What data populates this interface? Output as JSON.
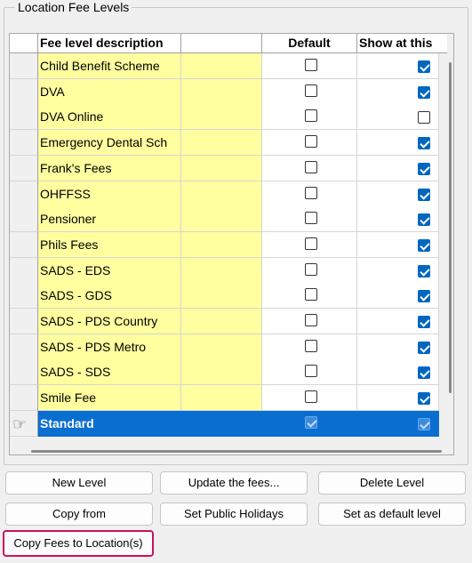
{
  "group": {
    "title": "Location Fee Levels"
  },
  "grid": {
    "columns": [
      "Fee level description",
      "Default",
      "Show at this"
    ],
    "rows": [
      {
        "name": "Child Benefit Scheme",
        "default": false,
        "show": true
      },
      {
        "name": "DVA",
        "default": false,
        "show": true
      },
      {
        "name": "DVA Online",
        "default": false,
        "show": false
      },
      {
        "name": "Emergency Dental Sch",
        "default": false,
        "show": true
      },
      {
        "name": "Frank's Fees",
        "default": false,
        "show": true
      },
      {
        "name": "OHFFSS",
        "default": false,
        "show": true
      },
      {
        "name": "Pensioner",
        "default": false,
        "show": true
      },
      {
        "name": "Phils Fees",
        "default": false,
        "show": true
      },
      {
        "name": "SADS - EDS",
        "default": false,
        "show": true
      },
      {
        "name": "SADS - GDS",
        "default": false,
        "show": true
      },
      {
        "name": "SADS - PDS Country",
        "default": false,
        "show": true
      },
      {
        "name": "SADS - PDS Metro",
        "default": false,
        "show": true
      },
      {
        "name": "SADS - SDS",
        "default": false,
        "show": true
      },
      {
        "name": "Smile Fee",
        "default": false,
        "show": true
      },
      {
        "name": "Standard",
        "default": true,
        "show": true,
        "selected": true
      }
    ]
  },
  "buttons": {
    "new_level": "New Level",
    "update_fees": "Update the fees...",
    "delete_level": "Delete Level",
    "copy_from": "Copy from",
    "set_public_holidays": "Set Public Holidays",
    "set_default_level": "Set as default level",
    "copy_fees_to_locations": "Copy Fees to Location(s)"
  },
  "colors": {
    "selection": "#0a6ed1",
    "description_bg": "#ffffa0",
    "highlight_border": "#c8125d"
  }
}
